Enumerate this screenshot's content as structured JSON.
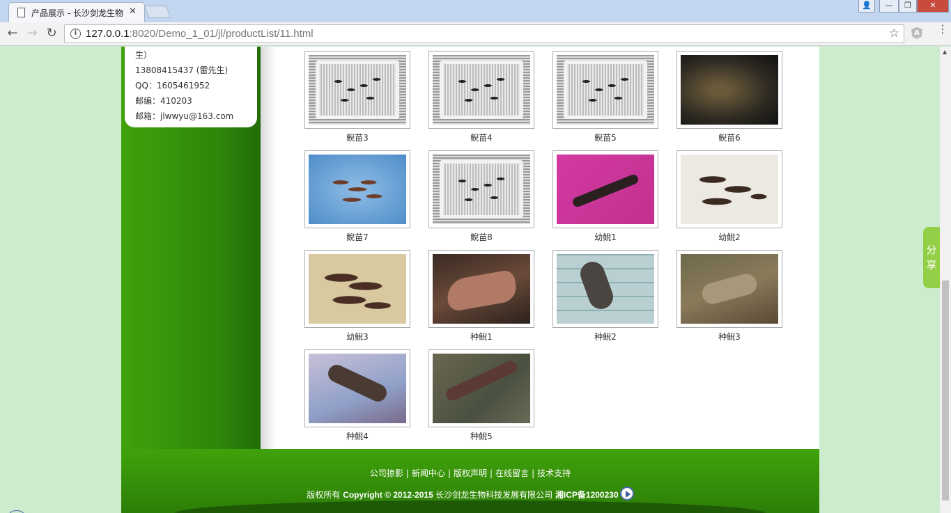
{
  "browser": {
    "tab_title": "产品展示 - 长沙剑龙生物",
    "tab_close": "✕",
    "url_host": "127.0.0.1",
    "url_rest": ":8020/Demo_1_01/jl/productList/11.html",
    "window_buttons": [
      "👤",
      "—",
      "❐",
      "✕"
    ]
  },
  "sidebar": {
    "contact_lines": [
      "生）",
      "13808415437 (雷先生)",
      "QQ：1605461952",
      "邮编：410203",
      "邮箱：jlwwyu@163.com"
    ]
  },
  "products": [
    {
      "caption": "鲵苗3",
      "img": "tray"
    },
    {
      "caption": "鲵苗4",
      "img": "tray"
    },
    {
      "caption": "鲵苗5",
      "img": "tray"
    },
    {
      "caption": "鲵苗6",
      "img": "dark-tank"
    },
    {
      "caption": "鲵苗7",
      "img": "blue-water"
    },
    {
      "caption": "鲵苗8",
      "img": "tray"
    },
    {
      "caption": "幼鲵1",
      "img": "pink"
    },
    {
      "caption": "幼鲵2",
      "img": "white-tank"
    },
    {
      "caption": "幼鲵3",
      "img": "yellow-tank"
    },
    {
      "caption": "种鲵1",
      "img": "brown-big"
    },
    {
      "caption": "种鲵2",
      "img": "tile"
    },
    {
      "caption": "种鲵3",
      "img": "rocky"
    },
    {
      "caption": "种鲵4",
      "img": "rocky-blue"
    },
    {
      "caption": "种鲵5",
      "img": "stones"
    }
  ],
  "footer": {
    "links": [
      "公司掠影",
      "新闻中心",
      "版权声明",
      "在线留言",
      "技术支持"
    ],
    "separator": "|",
    "copyright_prefix": "版权所有 ",
    "copyright_bold": "Copyright © 2012-2015 ",
    "copyright_company": "长沙剑龙生物科技发展有限公司 ",
    "icp_bold": "湘ICP备1200230"
  },
  "share": {
    "label_1": "分",
    "label_2": "享"
  }
}
